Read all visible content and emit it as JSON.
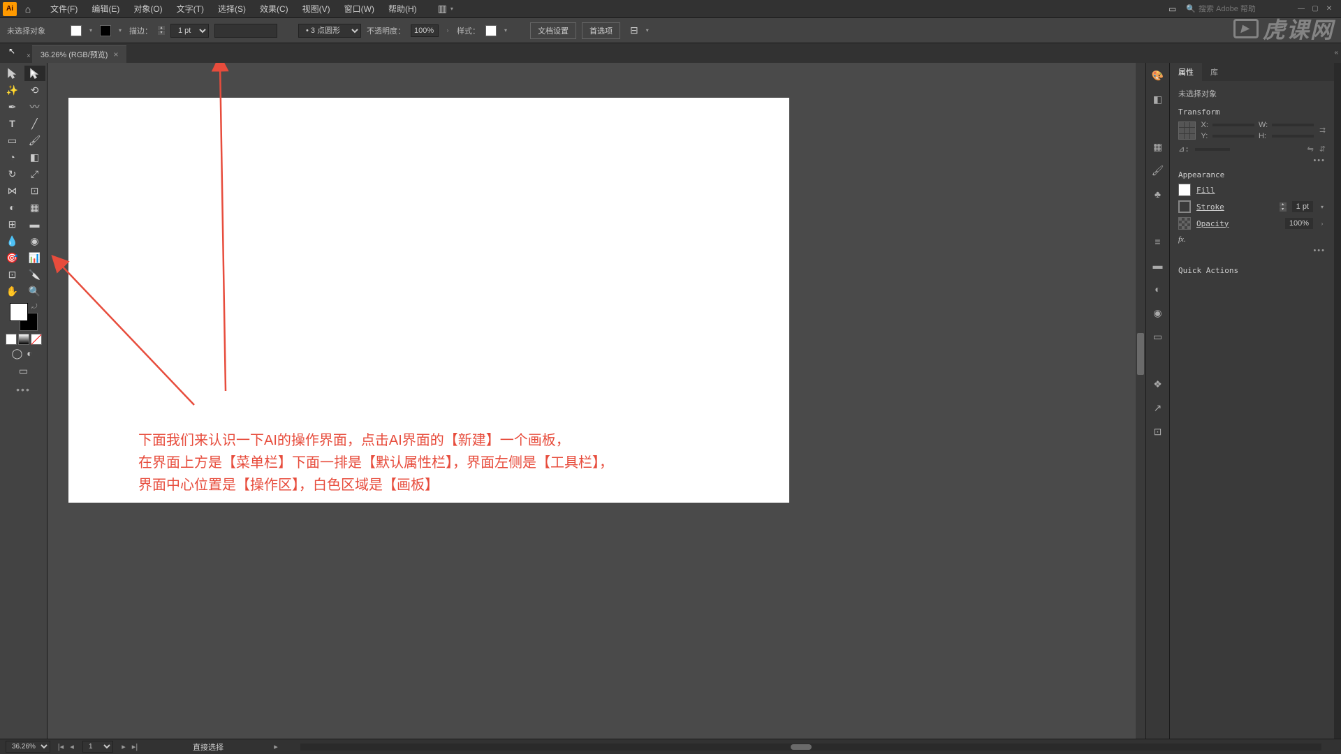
{
  "menubar": {
    "items": [
      "文件(F)",
      "编辑(E)",
      "对象(O)",
      "文字(T)",
      "选择(S)",
      "效果(C)",
      "视图(V)",
      "窗口(W)",
      "帮助(H)"
    ],
    "search_placeholder": "搜索 Adobe 帮助"
  },
  "controlbar": {
    "no_selection": "未选择对象",
    "stroke_label": "描边：",
    "stroke_value": "1 pt",
    "brush_value": "3 点圆形",
    "opacity_label": "不透明度：",
    "opacity_value": "100%",
    "style_label": "样式：",
    "doc_setup": "文档设置",
    "prefs": "首选项"
  },
  "tab": {
    "title": "36.26% (RGB/预览)",
    "close": "×"
  },
  "annotation": {
    "line1": "下面我们来认识一下AI的操作界面，点击AI界面的【新建】一个画板，",
    "line2": "在界面上方是【菜单栏】下面一排是【默认属性栏】，界面左侧是【工具栏】，",
    "line3": "界面中心位置是【操作区】，白色区域是【画板】"
  },
  "props": {
    "tab_props": "属性",
    "tab_lib": "库",
    "no_selection": "未选择对象",
    "transform_title": "Transform",
    "x_label": "X:",
    "y_label": "Y:",
    "w_label": "W:",
    "h_label": "H:",
    "angle_label": "⊿:",
    "appearance_title": "Appearance",
    "fill_label": "Fill",
    "stroke_label": "Stroke",
    "stroke_val": "1 pt",
    "opacity_label": "Opacity",
    "opacity_val": "100%",
    "fx_label": "fx.",
    "quick_actions": "Quick Actions"
  },
  "statusbar": {
    "zoom": "36.26%",
    "artboard_num": "1",
    "tool_hint": "直接选择"
  },
  "watermark": "虎课网"
}
